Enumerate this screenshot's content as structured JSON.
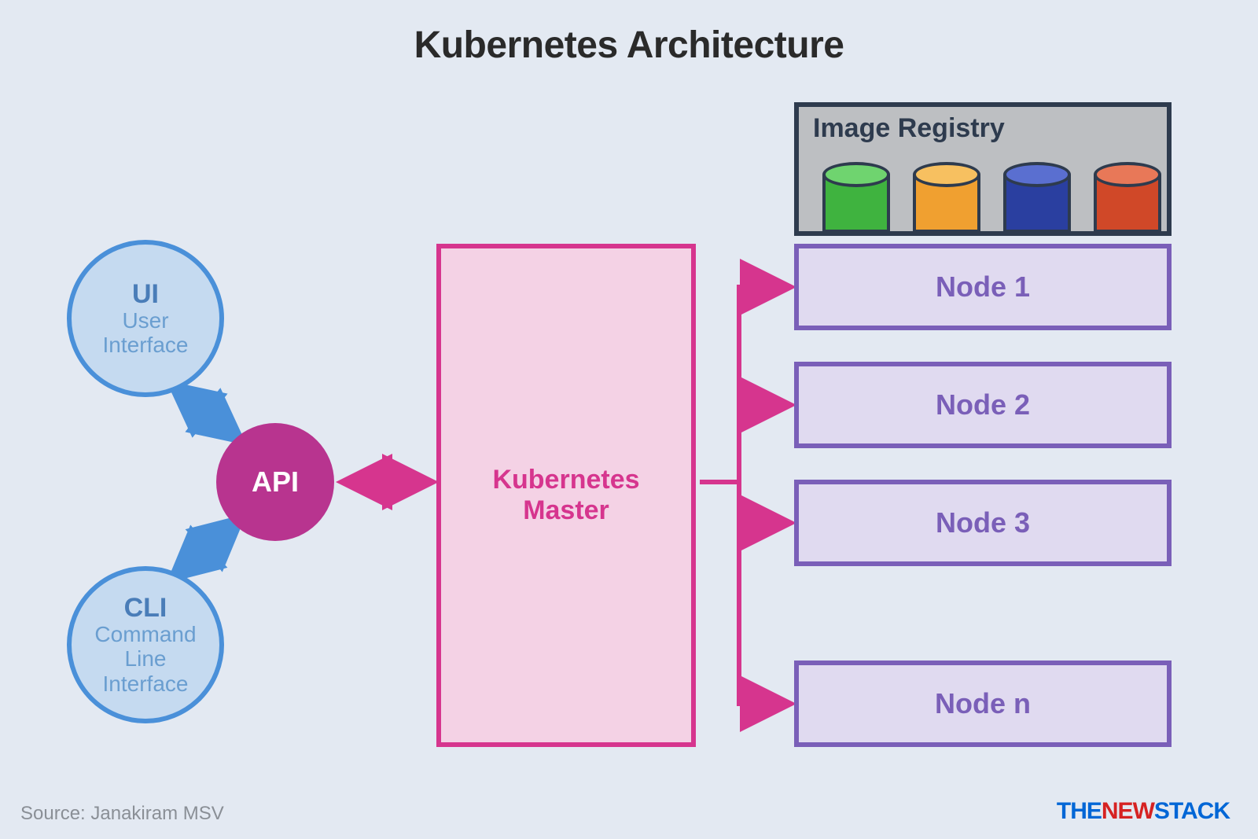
{
  "title": "Kubernetes Architecture",
  "ui": {
    "heading": "UI",
    "sub1": "User",
    "sub2": "Interface"
  },
  "cli": {
    "heading": "CLI",
    "sub1": "Command",
    "sub2": "Line",
    "sub3": "Interface"
  },
  "api": {
    "label": "API"
  },
  "master": {
    "line1": "Kubernetes",
    "line2": "Master"
  },
  "registry": {
    "label": "Image Registry",
    "cylinder_colors": [
      "green",
      "orange",
      "blue",
      "red"
    ]
  },
  "nodes": [
    "Node 1",
    "Node 2",
    "Node 3",
    "Node n"
  ],
  "source": "Source: Janakiram MSV",
  "brand": {
    "the": "THE",
    "new": "NEW",
    "stack": "STACK"
  },
  "connections": [
    {
      "from": "ui",
      "to": "api",
      "type": "bidirectional"
    },
    {
      "from": "cli",
      "to": "api",
      "type": "bidirectional"
    },
    {
      "from": "api",
      "to": "master",
      "type": "bidirectional"
    },
    {
      "from": "master",
      "to": "node1",
      "type": "unidirectional"
    },
    {
      "from": "master",
      "to": "node2",
      "type": "unidirectional"
    },
    {
      "from": "master",
      "to": "node3",
      "type": "unidirectional"
    },
    {
      "from": "master",
      "to": "noden",
      "type": "unidirectional"
    }
  ],
  "colors": {
    "bg": "#e3e9f2",
    "blue_border": "#4a90d9",
    "blue_fill": "#c5daf0",
    "api_fill": "#b8348f",
    "master_fill": "#f4d2e5",
    "master_border": "#d6358e",
    "node_fill": "#e0daf0",
    "node_border": "#7a5fb8",
    "registry_fill": "#bdbfc2",
    "registry_border": "#2e3b4e"
  }
}
